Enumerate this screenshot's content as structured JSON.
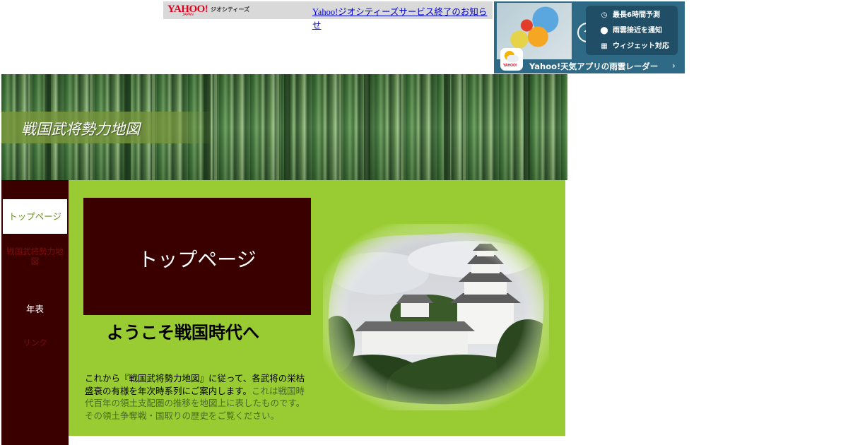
{
  "yahoo_bar": {
    "logo": "YAHOO!",
    "logo_sub": "JAPAN",
    "service": "ジオシティーズ",
    "notice_link": "Yahoo!ジオシティーズサービス終了のお知らせ"
  },
  "weather_ad": {
    "features": [
      {
        "icon": "clock-icon",
        "glyph": "◷",
        "label": "最長6時間予測"
      },
      {
        "icon": "pin-icon",
        "glyph": "⬤",
        "label": "雨雲接近を通知"
      },
      {
        "icon": "widget-icon",
        "glyph": "▦",
        "label": "ウィジェット対応"
      }
    ],
    "app_icon_brand": "YAHOO!",
    "cta": "Yahoo!天気アプリの雨雲レーダー",
    "cta_arrow": "›"
  },
  "banner": {
    "site_title": "戦国武将勢力地図"
  },
  "sidebar": {
    "items": [
      {
        "label": "トップページ",
        "active": true
      },
      {
        "label": "戦国武将勢力地図"
      },
      {
        "label": "年表"
      },
      {
        "label": "リンク"
      }
    ]
  },
  "main": {
    "heading": "トップページ",
    "welcome": "ようこそ戦国時代へ",
    "intro_strong": "これから『戦国武将勢力地図』に従って、各武将の栄枯盛衰の有様を年次時系列にご案内します。",
    "intro_dim": "これは戦国時代百年の領土支配圏の推移を地図上に表したものです。その領土争奪戦・国取りの歴史をご覧ください。"
  },
  "colors": {
    "main_bg": "#99cc33",
    "sidebar_bg": "#3a0000",
    "heading_box": "#3a0000",
    "link": "#0000cc"
  }
}
